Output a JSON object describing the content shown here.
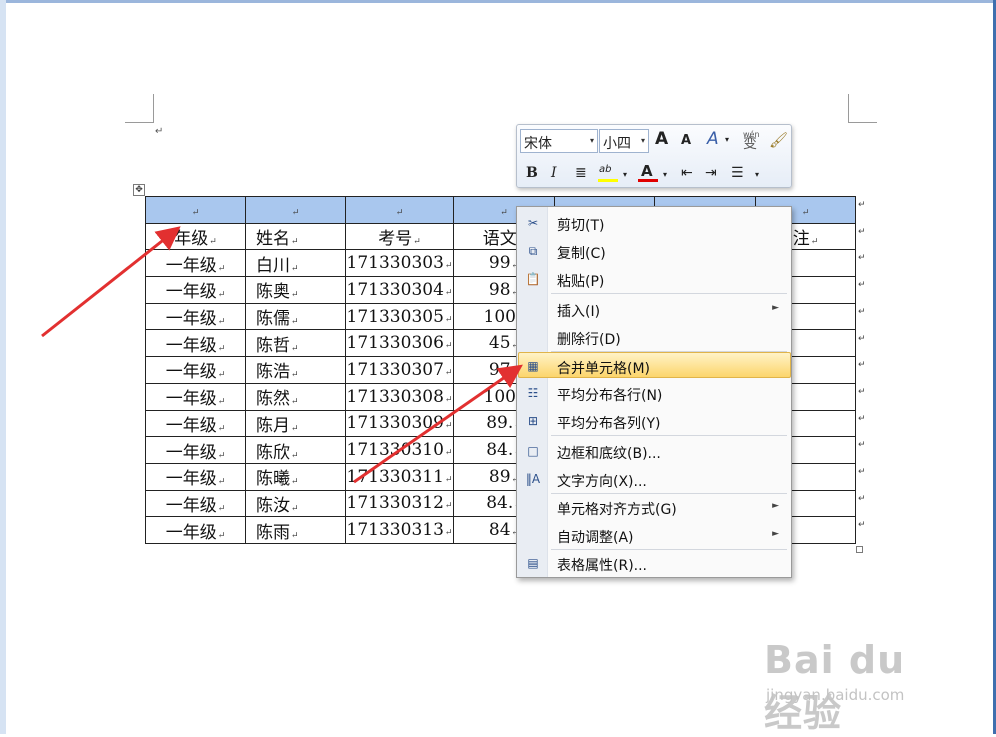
{
  "document": {
    "paragraph_mark": "↵",
    "table": {
      "columns": 7,
      "header_row_selected": true,
      "rows": [
        [
          "年级",
          "姓名",
          "考号",
          "语文",
          "",
          "",
          "注"
        ],
        [
          "一年级",
          "白川",
          "171330303",
          "99",
          "",
          "",
          ""
        ],
        [
          "一年级",
          "陈奥",
          "171330304",
          "98",
          "",
          "",
          ""
        ],
        [
          "一年级",
          "陈儒",
          "171330305",
          "100",
          "",
          "",
          ""
        ],
        [
          "一年级",
          "陈哲",
          "171330306",
          "45",
          "",
          "",
          ""
        ],
        [
          "一年级",
          "陈浩",
          "171330307",
          "97",
          "",
          "",
          ""
        ],
        [
          "一年级",
          "陈然",
          "171330308",
          "100",
          "",
          "",
          ""
        ],
        [
          "一年级",
          "陈月",
          "171330309",
          "89.",
          "",
          "",
          ""
        ],
        [
          "一年级",
          "陈欣",
          "171330310",
          "84.",
          "",
          "",
          ""
        ],
        [
          "一年级",
          "陈曦",
          "171330311",
          "89",
          "",
          "",
          ""
        ],
        [
          "一年级",
          "陈汝",
          "171330312",
          "84.",
          "",
          "",
          ""
        ],
        [
          "一年级",
          "陈雨",
          "171330313",
          "84",
          "",
          "",
          ""
        ]
      ]
    }
  },
  "mini_toolbar": {
    "font_name": "宋体",
    "font_size": "小四",
    "grow_font": "A",
    "shrink_font": "A",
    "styles": "A",
    "phonetic": "wén",
    "phonetic_char": "变",
    "bold": "B",
    "italic": "I",
    "highlight": "ab",
    "font_color": "A",
    "highlight_color": "#ffff00",
    "font_color_value": "#e00000"
  },
  "context_menu": {
    "items": [
      {
        "label": "剪切(T)",
        "icon": "scissors-icon",
        "glyph": "✂"
      },
      {
        "label": "复制(C)",
        "icon": "copy-icon",
        "glyph": "⧉"
      },
      {
        "label": "粘贴(P)",
        "icon": "paste-icon",
        "glyph": "📋"
      },
      {
        "label": "插入(I)",
        "icon": "",
        "glyph": "",
        "submenu": true
      },
      {
        "label": "删除行(D)",
        "icon": "",
        "glyph": ""
      },
      {
        "label": "合并单元格(M)",
        "icon": "merge-cells-icon",
        "glyph": "▦",
        "highlighted": true
      },
      {
        "label": "平均分布各行(N)",
        "icon": "distribute-rows-icon",
        "glyph": "☷"
      },
      {
        "label": "平均分布各列(Y)",
        "icon": "distribute-columns-icon",
        "glyph": "⊞"
      },
      {
        "label": "边框和底纹(B)...",
        "icon": "borders-icon",
        "glyph": "□"
      },
      {
        "label": "文字方向(X)...",
        "icon": "text-direction-icon",
        "glyph": "‖A"
      },
      {
        "label": "单元格对齐方式(G)",
        "icon": "",
        "glyph": "",
        "submenu": true
      },
      {
        "label": "自动调整(A)",
        "icon": "",
        "glyph": "",
        "submenu": true
      },
      {
        "label": "表格属性(R)...",
        "icon": "table-properties-icon",
        "glyph": "▤"
      }
    ],
    "submenu_arrow": "►",
    "highlight_color": "#fcd56c"
  },
  "annotation_color": "#e23030",
  "watermark": {
    "text": "Bai du 经验",
    "url": "jingyan.baidu.com"
  }
}
